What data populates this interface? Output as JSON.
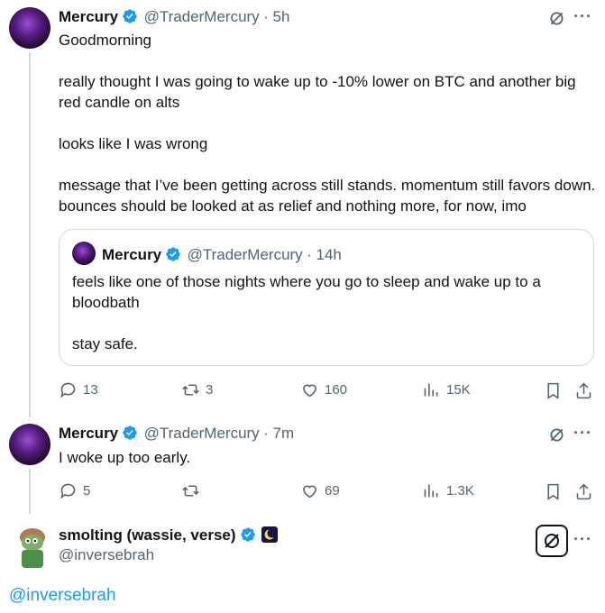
{
  "post1": {
    "name": "Mercury",
    "handle": "@TraderMercury",
    "time": "· 5h",
    "paragraphs": [
      "Goodmorning",
      "really thought I was going to wake up to -10% lower on BTC and another big red candle on alts",
      "looks like I was wrong",
      "message that I’ve been getting across still stands. momentum still favors down. bounces should be looked at as relief and nothing more, for now, imo"
    ],
    "quote": {
      "name": "Mercury",
      "handle": "@TraderMercury",
      "time": "· 14h",
      "paragraphs": [
        "feels like one of those nights where you go to sleep and wake up to a bloodbath",
        "stay safe."
      ]
    },
    "actions": {
      "replies": "13",
      "reposts": "3",
      "likes": "160",
      "views": "15K"
    }
  },
  "post2": {
    "name": "Mercury",
    "handle": "@TraderMercury",
    "time": "· 7m",
    "text": "I woke up too early.",
    "actions": {
      "replies": "5",
      "reposts": "",
      "likes": "69",
      "views": "1.3K"
    }
  },
  "post3": {
    "name": "smolting (wassie, verse)",
    "handle": "@inversebrah",
    "link": "@inversebrah"
  },
  "more_label": "···",
  "colors": {
    "accent": "#1d9bf0",
    "text": "#0f1419",
    "muted": "#536471",
    "border": "#cfd9de"
  }
}
